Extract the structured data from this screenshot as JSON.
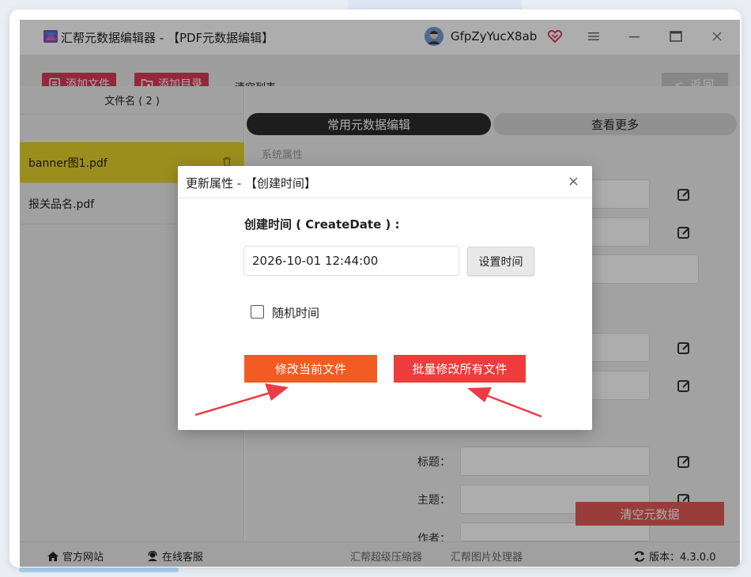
{
  "app": {
    "title": "汇帮元数据编辑器 - 【PDF元数据编辑】",
    "username": "GfpZyYucX8ab"
  },
  "toolbar": {
    "add_file": "添加文件",
    "add_dir": "添加目录",
    "clear_list": "清空列表",
    "back": "< 返回"
  },
  "file_list": {
    "header": "文件名 ( 2 )",
    "files": [
      "banner图1.pdf",
      "报关品名.pdf"
    ]
  },
  "tabs": {
    "common": "常用元数据编辑",
    "more": "查看更多"
  },
  "section": {
    "system_props": "系统属性"
  },
  "fields": {
    "title": "标题：",
    "subject": "主题：",
    "author": "作者："
  },
  "actions": {
    "clear_data": "清空元数据"
  },
  "dialog": {
    "title": "更新属性 - 【创建时间】",
    "close": "×",
    "label": "创建时间 ( CreateDate ) :",
    "datetime_value": "2026-10-01 12:44:00",
    "set_time": "设置时间",
    "random_time": "随机时间",
    "random_checked": false,
    "modify_current": "修改当前文件",
    "modify_all": "批量修改所有文件"
  },
  "statusbar": {
    "official_site": "官方网站",
    "online_service": "在线客服",
    "compressor": "汇帮超级压缩器",
    "image_tool": "汇帮图片处理器",
    "version": "版本：4.3.0.0"
  },
  "colors": {
    "toolbar_button": "#d73b5a",
    "active_file": "#e6d22a",
    "orange_button": "#f25b22",
    "red_button": "#ee3b3b",
    "arrow": "#ea3c47"
  }
}
